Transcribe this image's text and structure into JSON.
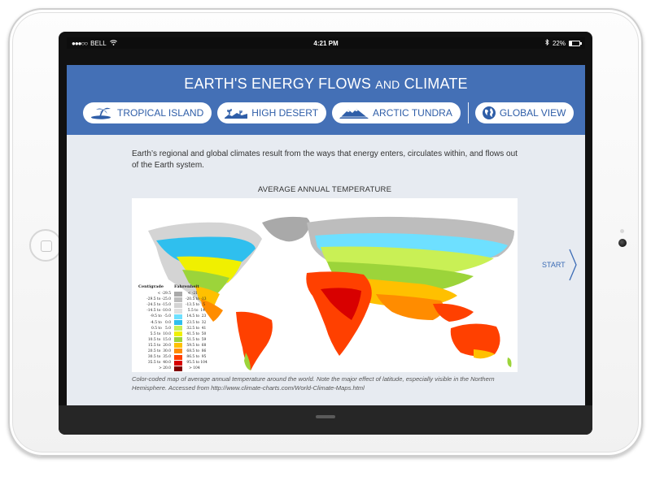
{
  "status_bar": {
    "carrier": "BELL",
    "time": "4:21 PM",
    "battery": "22%",
    "signal_icon": "signal-dots-icon",
    "wifi_icon": "wifi-icon",
    "bluetooth_icon": "bluetooth-icon",
    "battery_level": 0.22
  },
  "header": {
    "title_main": "EARTH'S ENERGY FLOWS",
    "title_and": "AND",
    "title_end": "CLIMATE",
    "color": "#4470b6"
  },
  "nav": {
    "items": [
      {
        "label": "TROPICAL ISLAND",
        "icon": "palm-island-icon"
      },
      {
        "label": "HIGH DESERT",
        "icon": "desert-cactus-icon"
      },
      {
        "label": "ARCTIC TUNDRA",
        "icon": "mountain-icon"
      },
      {
        "label": "GLOBAL VIEW",
        "icon": "globe-icon"
      }
    ]
  },
  "content": {
    "intro": "Earth’s regional and global climates result from the ways that energy enters, circulates within, and flows out of the Earth system.",
    "map_title": "AVERAGE ANNUAL TEMPERATURE",
    "caption": "Color-coded map of average annual temperature around the world. Note the major effect of latitude, especially visible in the Northern Hemisphere. Accessed from http://www.climate-charts.com/World-Climate-Maps.html",
    "start_label": "START"
  },
  "legend": {
    "centigrade_label": "Centigrade",
    "fahrenheit_label": "Fahrenheit",
    "rows": [
      {
        "c": "     < -29.5",
        "f": "  < -21",
        "color": "#a9a9a9"
      },
      {
        "c": "-29.5 to -25.0",
        "f": "-20.5 to -13",
        "color": "#bdbdbd"
      },
      {
        "c": "-24.5 to -15.0",
        "f": "-13.5 to   5",
        "color": "#d4d4d4"
      },
      {
        "c": "-14.5 to -10.0",
        "f": "  5.5 to  14",
        "color": "#e0e0e0"
      },
      {
        "c": " -9.5 to  -5.0",
        "f": " 14.5 to  23",
        "color": "#6ee0ff"
      },
      {
        "c": " -4.5 to   0.0",
        "f": " 23.5 to  32",
        "color": "#2fbfee"
      },
      {
        "c": "  0.5 to   5.0",
        "f": " 32.5 to  41",
        "color": "#c9f055"
      },
      {
        "c": "  5.5 to  10.0",
        "f": " 41.5 to  50",
        "color": "#f0f000"
      },
      {
        "c": " 10.5 to  15.0",
        "f": " 51.5 to  59",
        "color": "#9cd43a"
      },
      {
        "c": " 15.5 to  20.0",
        "f": " 59.5 to  68",
        "color": "#ffc000"
      },
      {
        "c": " 20.5 to  30.0",
        "f": " 68.5 to  86",
        "color": "#ff8c00"
      },
      {
        "c": " 30.5 to  35.0",
        "f": " 86.5 to  95",
        "color": "#ff4000"
      },
      {
        "c": " 35.5 to  40.0",
        "f": " 95.5 to 104",
        "color": "#d80000"
      },
      {
        "c": "      > 20.0",
        "f": "   > 104",
        "color": "#800000"
      }
    ]
  }
}
